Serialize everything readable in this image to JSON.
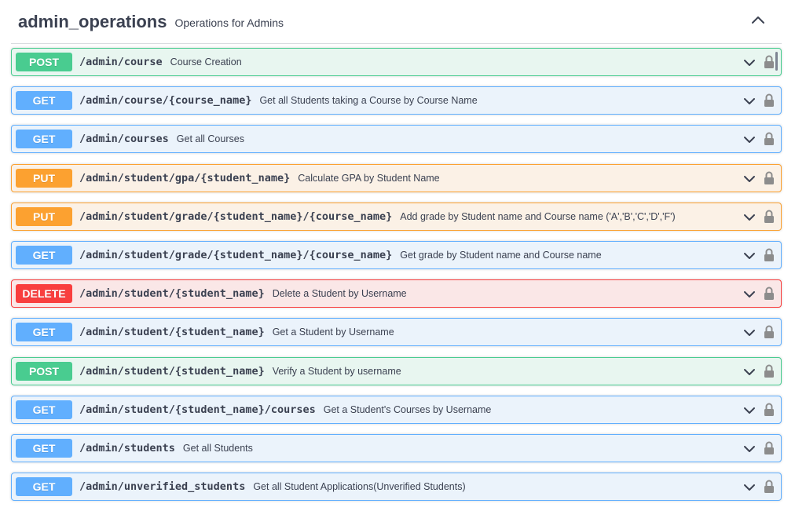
{
  "tag": {
    "name": "admin_operations",
    "description": "Operations for Admins",
    "collapse_icon": "chevron-up-icon"
  },
  "operations": [
    {
      "method": "POST",
      "path": "/admin/course",
      "summary": "Course Creation"
    },
    {
      "method": "GET",
      "path": "/admin/course/{course_name}",
      "summary": "Get all Students taking a Course by Course Name"
    },
    {
      "method": "GET",
      "path": "/admin/courses",
      "summary": "Get all Courses"
    },
    {
      "method": "PUT",
      "path": "/admin/student/gpa/{student_name}",
      "summary": "Calculate GPA by Student Name"
    },
    {
      "method": "PUT",
      "path": "/admin/student/grade/{student_name}/{course_name}",
      "summary": "Add grade by Student name and Course name ('A','B','C','D','F')"
    },
    {
      "method": "GET",
      "path": "/admin/student/grade/{student_name}/{course_name}",
      "summary": "Get grade by Student name and Course name"
    },
    {
      "method": "DELETE",
      "path": "/admin/student/{student_name}",
      "summary": "Delete a Student by Username"
    },
    {
      "method": "GET",
      "path": "/admin/student/{student_name}",
      "summary": "Get a Student by Username"
    },
    {
      "method": "POST",
      "path": "/admin/student/{student_name}",
      "summary": "Verify a Student by username"
    },
    {
      "method": "GET",
      "path": "/admin/student/{student_name}/courses",
      "summary": "Get a Student's Courses by Username"
    },
    {
      "method": "GET",
      "path": "/admin/students",
      "summary": "Get all Students"
    },
    {
      "method": "GET",
      "path": "/admin/unverified_students",
      "summary": "Get all Student Applications(Unverified Students)"
    }
  ],
  "colors": {
    "get": "#61affe",
    "post": "#49cc90",
    "put": "#fca130",
    "delete": "#f93e3e"
  },
  "icons": {
    "expand": "chevron-down-icon",
    "auth": "lock-icon"
  }
}
